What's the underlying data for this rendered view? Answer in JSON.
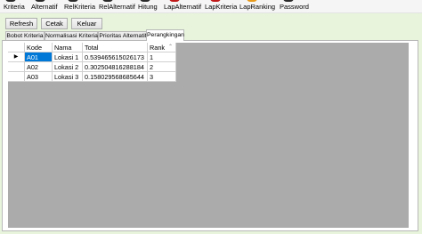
{
  "menu": {
    "items": [
      {
        "label": "Kriteria",
        "icon": "kriteria-icon",
        "color": "#2a2a2a"
      },
      {
        "label": "Alternatif",
        "icon": "alternatif-icon",
        "color": "#2a2a2a"
      },
      {
        "label": "RelKriteria",
        "icon": "relkriteria-icon",
        "color": "#2a2a2a"
      },
      {
        "label": "RelAlternatif",
        "icon": "relalternatif-icon",
        "color": "#2a2a2a"
      },
      {
        "label": "Hitung",
        "icon": "hitung-icon",
        "color": "#2a2a2a"
      },
      {
        "label": "LapAlternatif",
        "icon": "lapalternatif-icon",
        "color": "#c01818"
      },
      {
        "label": "LapKriteria",
        "icon": "lapkriteria-icon",
        "color": "#c01818"
      },
      {
        "label": "LapRanking",
        "icon": "lapranking-icon",
        "color": "#e89a1a"
      },
      {
        "label": "Password",
        "icon": "password-icon",
        "color": "#2a2a2a"
      }
    ]
  },
  "toolbar": {
    "refresh_label": "Refresh",
    "cetak_label": "Cetak",
    "keluar_label": "Keluar"
  },
  "tabs": [
    {
      "label": "Bobot Kriteria",
      "active": false
    },
    {
      "label": "Normalisasi Kriteria",
      "active": false
    },
    {
      "label": "Prioritas Alternatif",
      "active": false
    },
    {
      "label": "Perangkingan",
      "active": true
    }
  ],
  "grid": {
    "columns": [
      "Kode",
      "Nama",
      "Total",
      "Rank"
    ],
    "sort_glyph": "⌃",
    "current_row_marker": "▶",
    "rows": [
      {
        "kode": "A01",
        "nama": "Lokasi 1",
        "total": "0.539465615026173",
        "rank": "1"
      },
      {
        "kode": "A02",
        "nama": "Lokasi 2",
        "total": "0.302504816288184",
        "rank": "2"
      },
      {
        "kode": "A03",
        "nama": "Lokasi 3",
        "total": "0.158029568685644",
        "rank": "3"
      }
    ]
  },
  "colors": {
    "panel_bg": "#e8f5dc",
    "grid_bg": "#ababab",
    "selection": "#0078d7"
  }
}
